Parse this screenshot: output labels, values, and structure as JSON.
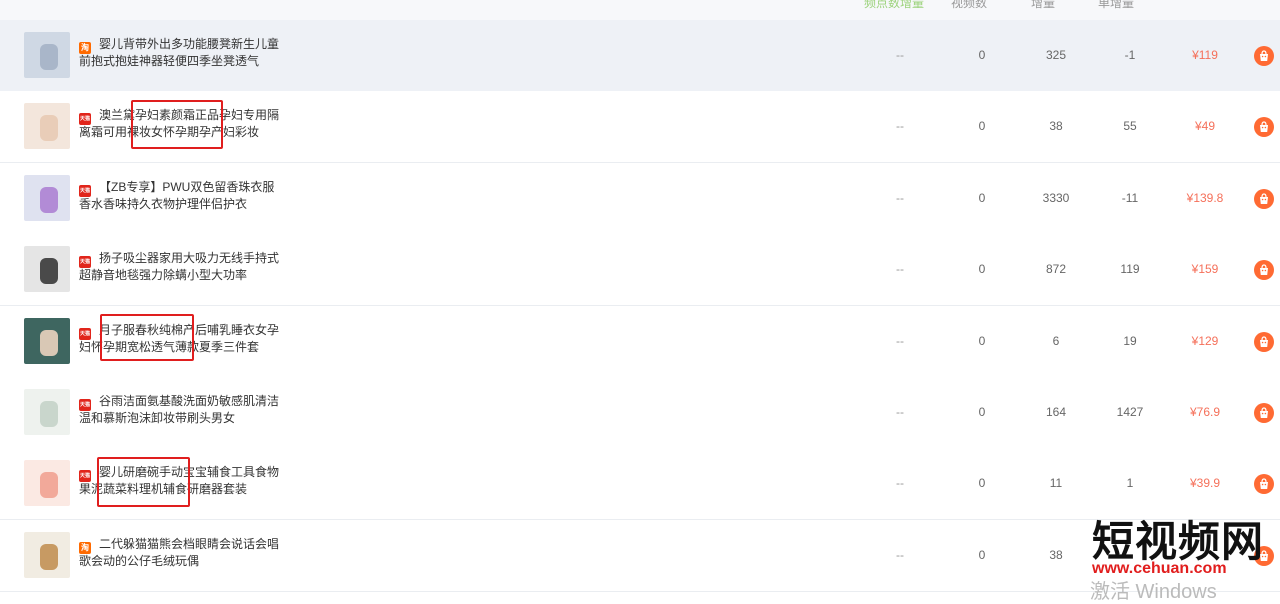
{
  "header": {
    "columns": [
      "频点数增量",
      "视频数",
      "增量",
      "单增量"
    ]
  },
  "products": [
    {
      "title": "婴儿背带外出多功能腰凳新生儿童前抱式抱娃神器轻便四季坐凳透气",
      "shop": "taobao",
      "c1": "--",
      "c2": "0",
      "c3": "325",
      "c4": "-1",
      "price": "¥119",
      "colors": [
        "#cfd8e4",
        "#a9b6c9"
      ]
    },
    {
      "title": "澳兰黛孕妇素颜霜正品孕妇专用隔离霜可用裸妆女怀孕期孕产妇彩妆",
      "shop": "tmall",
      "c1": "--",
      "c2": "0",
      "c3": "38",
      "c4": "55",
      "price": "¥49",
      "colors": [
        "#f3e6dc",
        "#e9cdb8"
      ]
    },
    {
      "title": "【ZB专享】PWU双色留香珠衣服香水香味持久衣物护理伴侣护衣",
      "shop": "tmall",
      "c1": "--",
      "c2": "0",
      "c3": "3330",
      "c4": "-11",
      "price": "¥139.8",
      "colors": [
        "#dfe2f0",
        "#b28bd6"
      ]
    },
    {
      "title": "扬子吸尘器家用大吸力无线手持式超静音地毯强力除螨小型大功率",
      "shop": "tmall",
      "c1": "--",
      "c2": "0",
      "c3": "872",
      "c4": "119",
      "price": "¥159",
      "colors": [
        "#e5e5e5",
        "#4a4a4a"
      ]
    },
    {
      "title": "月子服春秋纯棉产后哺乳睡衣女孕妇怀孕期宽松透气薄款夏季三件套",
      "shop": "tmall",
      "c1": "--",
      "c2": "0",
      "c3": "6",
      "c4": "19",
      "price": "¥129",
      "colors": [
        "#3e6660",
        "#d9c8b5"
      ]
    },
    {
      "title": "谷雨洁面氨基酸洗面奶敏感肌清洁温和慕斯泡沫卸妆带刷头男女",
      "shop": "tmall",
      "c1": "--",
      "c2": "0",
      "c3": "164",
      "c4": "1427",
      "price": "¥76.9",
      "colors": [
        "#eef2ee",
        "#c9d6cc"
      ]
    },
    {
      "title": "婴儿研磨碗手动宝宝辅食工具食物果泥蔬菜料理机辅食研磨器套装",
      "shop": "tmall",
      "c1": "--",
      "c2": "0",
      "c3": "11",
      "c4": "1",
      "price": "¥39.9",
      "colors": [
        "#fbe9e3",
        "#f2a99a"
      ]
    },
    {
      "title": "二代躲猫猫熊会档眼睛会说话会唱歌会动的公仔毛绒玩偶",
      "shop": "taobao",
      "c1": "--",
      "c2": "0",
      "c3": "38",
      "c4": "",
      "price": "",
      "colors": [
        "#f1ece2",
        "#c79a63"
      ]
    }
  ],
  "badges": {
    "tmall": "天猫",
    "taobao": "淘"
  },
  "watermark": {
    "title": "短视频网",
    "url": "www.cehuan.com",
    "activate": "激活 Windows"
  }
}
